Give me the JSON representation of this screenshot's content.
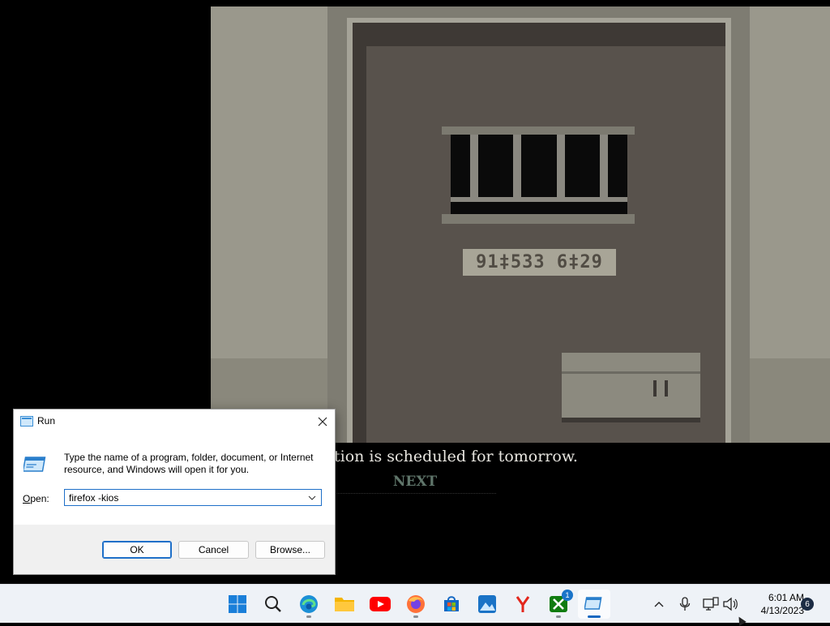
{
  "game": {
    "plate_text": "91‡533 6‡29",
    "dialogue": "tion is scheduled for tomorrow.",
    "next_label": "NEXT"
  },
  "run_dialog": {
    "title": "Run",
    "description": "Type the name of a program, folder, document, or Internet resource, and Windows will open it for you.",
    "open_label_prefix": "O",
    "open_label_rest": "pen:",
    "open_value": "firefox -kios",
    "ok_label": "OK",
    "cancel_label": "Cancel",
    "browse_label": "Browse..."
  },
  "taskbar": {
    "apps": [
      {
        "name": "start",
        "icon": "windows-logo"
      },
      {
        "name": "search",
        "icon": "search-icon"
      },
      {
        "name": "edge",
        "icon": "edge-icon"
      },
      {
        "name": "file-explorer",
        "icon": "folder-icon"
      },
      {
        "name": "youtube",
        "icon": "youtube-icon"
      },
      {
        "name": "firefox",
        "icon": "firefox-icon"
      },
      {
        "name": "microsoft-store",
        "icon": "store-icon"
      },
      {
        "name": "photos",
        "icon": "photos-icon"
      },
      {
        "name": "yandex",
        "icon": "yandex-icon"
      },
      {
        "name": "xbox",
        "icon": "xbox-icon",
        "badge": "1"
      },
      {
        "name": "run",
        "icon": "run-icon",
        "active": true
      }
    ],
    "tray": [
      "chevron-up-icon",
      "microphone-icon",
      "network-icon",
      "volume-icon"
    ],
    "time": "6:01 AM",
    "date": "4/13/2023",
    "notification_count": "6"
  },
  "colors": {
    "accent": "#1e6fc8",
    "door": "#58524c",
    "wall": "#9a988c"
  }
}
